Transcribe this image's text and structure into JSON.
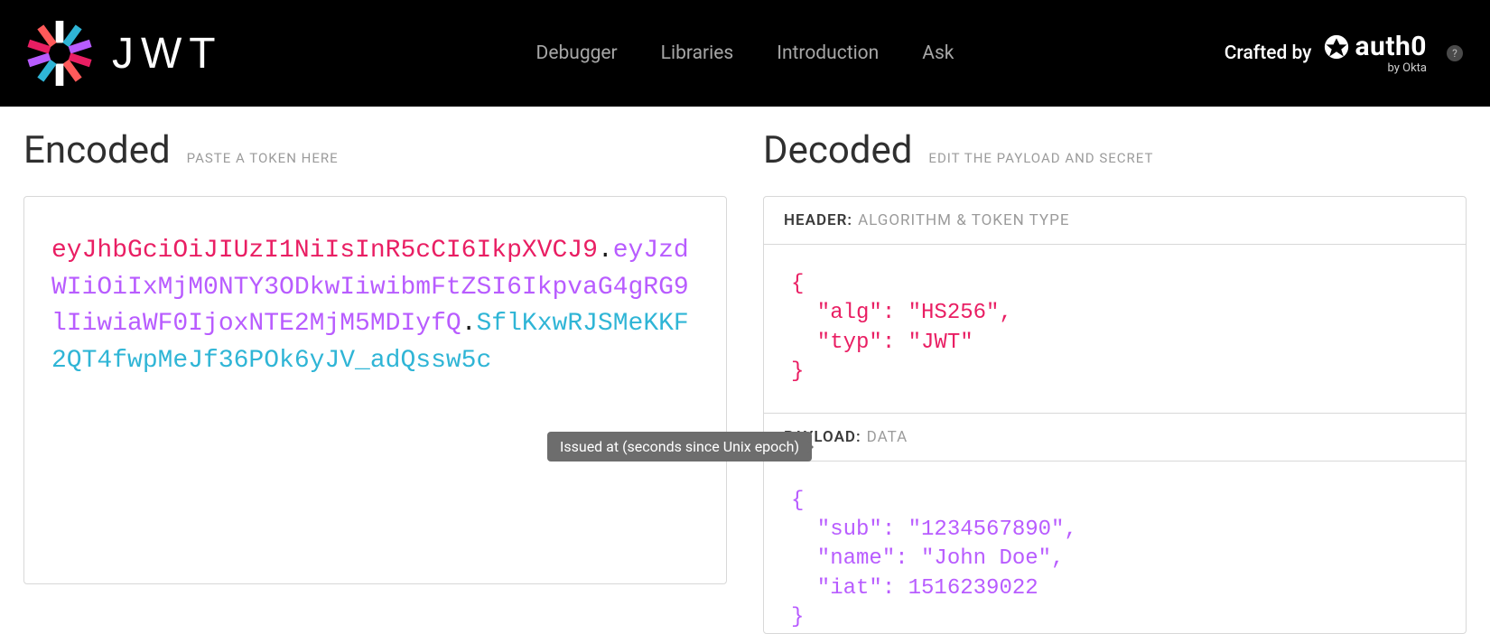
{
  "nav": {
    "debugger": "Debugger",
    "libraries": "Libraries",
    "introduction": "Introduction",
    "ask": "Ask"
  },
  "header": {
    "crafted_by": "Crafted by",
    "brand": "auth0",
    "by_okta": "by Okta",
    "help": "?"
  },
  "encoded": {
    "title": "Encoded",
    "hint": "PASTE A TOKEN HERE",
    "token_header": "eyJhbGciOiJIUzI1NiIsInR5cCI6IkpXVCJ9",
    "token_payload": "eyJzdWIiOiIxMjM0NTY3ODkwIiwibmFtZSI6IkpvaG4gRG9lIiwiaWF0IjoxNTE2MjM5MDIyfQ",
    "token_signature": "SflKxwRJSMeKKF2QT4fwpMeJf36POk6yJV_adQssw5c"
  },
  "decoded": {
    "title": "Decoded",
    "hint": "EDIT THE PAYLOAD AND SECRET",
    "header_label": "HEADER:",
    "header_sub": "ALGORITHM & TOKEN TYPE",
    "header_json": "{\n  \"alg\": \"HS256\",\n  \"typ\": \"JWT\"\n}",
    "payload_label": "PAYLOAD:",
    "payload_sub": "DATA",
    "payload_json": "{\n  \"sub\": \"1234567890\",\n  \"name\": \"John Doe\",\n  \"iat\": 1516239022\n}"
  },
  "tooltip": {
    "iat": "Issued at (seconds since Unix epoch)"
  }
}
